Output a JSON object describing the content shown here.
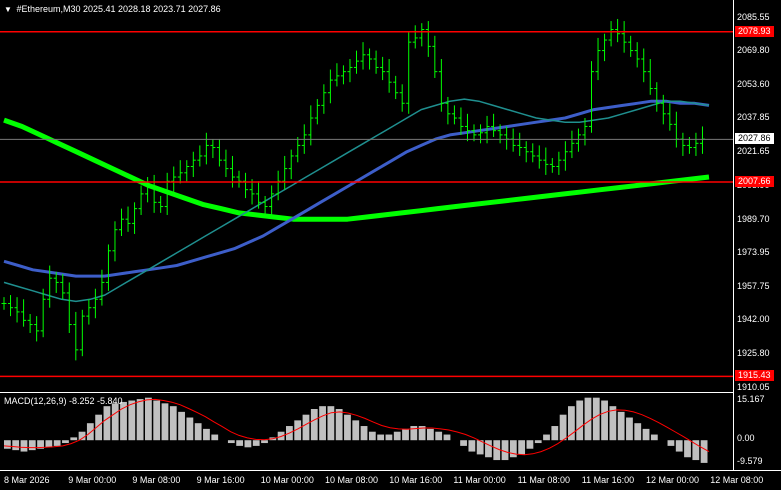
{
  "header": {
    "symbol_timeframe": "#Ethereum,M30",
    "ohlc": "2025.41 2028.18 2023.71 2027.86"
  },
  "macd": {
    "label": "MACD(12,26,9) -8.252 -5.840",
    "scale_top": "15.167",
    "scale_zero": "0.00",
    "scale_bottom": "-9.579"
  },
  "price_axis": {
    "labels": [
      "2085.55",
      "2069.80",
      "2053.60",
      "2037.85",
      "2021.65",
      "2005.90",
      "1989.70",
      "1973.95",
      "1957.75",
      "1942.00",
      "1925.80",
      "1910.05"
    ],
    "current_price": "2027.86"
  },
  "levels": [
    {
      "price": 2078.93,
      "label": "2078.93"
    },
    {
      "price": 2007.66,
      "label": "2007.66"
    },
    {
      "price": 1915.43,
      "label": "1915.43"
    }
  ],
  "time_axis": {
    "labels": [
      "8 Mar 2026",
      "9 Mar 00:00",
      "9 Mar 08:00",
      "9 Mar 16:00",
      "10 Mar 00:00",
      "10 Mar 08:00",
      "10 Mar 16:00",
      "11 Mar 00:00",
      "11 Mar 08:00",
      "11 Mar 16:00",
      "12 Mar 00:00",
      "12 Mar 08:00"
    ]
  },
  "colors": {
    "background": "#000000",
    "bars": "#00ff00",
    "level_line": "#ff0000",
    "level_tag": "#ff0000",
    "ma_fast": "#1f8f8f",
    "ma_mid": "#3d5ec9",
    "ma_slow": "#00ff00",
    "macd_hist": "#c0c0c0",
    "macd_signal": "#ff0000",
    "current_price_tag": "#ffffff"
  },
  "chart_data": {
    "type": "candlestick",
    "y_range": [
      1908,
      2094
    ],
    "candles_close": [
      1950,
      1948,
      1946,
      1942,
      1940,
      1937,
      1952,
      1962,
      1960,
      1955,
      1940,
      1928,
      1944,
      1948,
      1952,
      1960,
      1975,
      1985,
      1990,
      1988,
      1995,
      2002,
      2005,
      1998,
      1996,
      2008,
      2010,
      2012,
      2015,
      2018,
      2020,
      2025,
      2024,
      2018,
      2014,
      2010,
      2008,
      2004,
      2002,
      1998,
      1996,
      2002,
      2008,
      2014,
      2020,
      2025,
      2030,
      2038,
      2044,
      2050,
      2056,
      2058,
      2060,
      2062,
      2065,
      2068,
      2066,
      2062,
      2060,
      2055,
      2050,
      2045,
      2074,
      2076,
      2080,
      2072,
      2060,
      2045,
      2040,
      2038,
      2034,
      2032,
      2030,
      2031,
      2034,
      2032,
      2030,
      2028,
      2025,
      2024,
      2022,
      2020,
      2018,
      2016,
      2015,
      2018,
      2022,
      2026,
      2030,
      2034,
      2060,
      2070,
      2075,
      2080,
      2078,
      2074,
      2070,
      2066,
      2060,
      2052,
      2045,
      2040,
      2035,
      2028,
      2025,
      2024,
      2026,
      2028
    ],
    "ma_fast": [
      1960,
      1958,
      1956,
      1954,
      1952,
      1951,
      1952,
      1954,
      1958,
      1962,
      1966,
      1970,
      1974,
      1978,
      1982,
      1986,
      1990,
      1994,
      1998,
      2002,
      2006,
      2010,
      2014,
      2018,
      2022,
      2026,
      2030,
      2034,
      2038,
      2042,
      2044,
      2046,
      2047,
      2046,
      2044,
      2042,
      2040,
      2038,
      2037,
      2036,
      2036,
      2037,
      2038,
      2040,
      2042,
      2044,
      2046,
      2046,
      2045,
      2044
    ],
    "ma_mid": [
      1970,
      1968,
      1966,
      1965,
      1964,
      1963,
      1963,
      1963,
      1964,
      1965,
      1966,
      1967,
      1968,
      1970,
      1972,
      1974,
      1976,
      1979,
      1982,
      1986,
      1990,
      1994,
      1998,
      2002,
      2006,
      2010,
      2014,
      2018,
      2022,
      2025,
      2028,
      2030,
      2031,
      2032,
      2033,
      2034,
      2035,
      2036,
      2037,
      2038,
      2040,
      2042,
      2043,
      2044,
      2045,
      2046,
      2046,
      2045,
      2045,
      2044
    ],
    "ma_slow": [
      2037,
      2034,
      2030,
      2026,
      2022,
      2018,
      2014,
      2010,
      2006,
      2003,
      2000,
      1997,
      1995,
      1993,
      1992,
      1991,
      1990,
      1990,
      1990,
      1990,
      1991,
      1992,
      1993,
      1994,
      1995,
      1996,
      1997,
      1998,
      1999,
      2000,
      2001,
      2002,
      2003,
      2004,
      2005,
      2006,
      2007,
      2008,
      2009,
      2010
    ],
    "macd_hist": [
      -3,
      -3.5,
      -4,
      -3.5,
      -3,
      -2.5,
      -2,
      -1,
      1,
      3,
      6,
      9,
      12,
      13,
      13.5,
      14,
      14.5,
      15,
      14,
      13,
      12,
      10,
      8,
      6,
      4,
      2,
      0,
      -1,
      -2,
      -2.5,
      -2,
      -1,
      1,
      3,
      5,
      7,
      9,
      11,
      12,
      12,
      11,
      9,
      7,
      5,
      3,
      2,
      2,
      3,
      4,
      5,
      5,
      4,
      3,
      2,
      0,
      -2,
      -4,
      -5,
      -6,
      -7,
      -7,
      -6,
      -5,
      -3,
      -1,
      2,
      5,
      9,
      12,
      14,
      15,
      15,
      14,
      12,
      10,
      8,
      6,
      4,
      2,
      0,
      -2,
      -4,
      -6,
      -7,
      -8
    ],
    "macd_signal": [
      -2,
      -2.2,
      -2.5,
      -2.6,
      -2.6,
      -2.5,
      -2.3,
      -2,
      -1.2,
      0,
      2,
      4.5,
      7,
      9,
      11,
      12.5,
      13.5,
      14.2,
      14.4,
      14,
      13.4,
      12.5,
      11.2,
      9.8,
      8.3,
      6.5,
      4.8,
      3,
      1.7,
      0.8,
      0.3,
      0.2,
      0.5,
      1.3,
      2.5,
      4,
      5.6,
      7.2,
      8.6,
      9.7,
      10,
      9.6,
      8.8,
      7.7,
      6.4,
      5.2,
      4.4,
      4,
      3.9,
      4.1,
      4.3,
      4.3,
      4,
      3.6,
      2.9,
      2,
      0.8,
      -0.6,
      -2,
      -3.3,
      -4.3,
      -4.9,
      -5.1,
      -4.8,
      -4,
      -2.8,
      -1.2,
      0.8,
      3,
      5.3,
      7.4,
      9.1,
      10.2,
      10.7,
      10.6,
      10,
      9,
      7.7,
      6.2,
      4.6,
      2.9,
      1.2,
      -0.6,
      -2.4,
      -4
    ]
  }
}
